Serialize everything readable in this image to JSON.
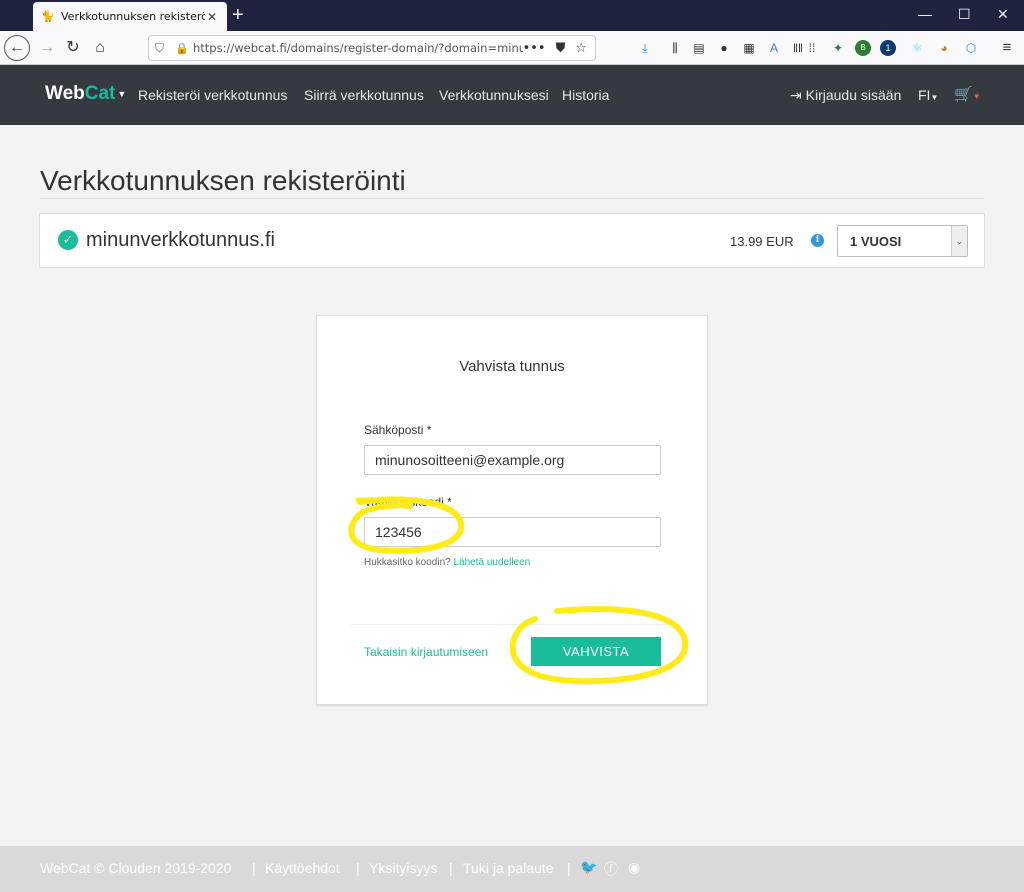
{
  "browser": {
    "tab_title": "Verkkotunnuksen rekisteröinti |",
    "url": "https://webcat.fi/domains/register-domain/?domain=minunve",
    "new_tab": "+",
    "menu": "≡"
  },
  "header": {
    "brand_web": "Web",
    "brand_cat": "Cat",
    "nav": [
      "Rekisteröi verkkotunnus",
      "Siirrä verkkotunnus",
      "Verkkotunnuksesi",
      "Historia"
    ],
    "login": "Kirjaudu sisään",
    "lang": "FI"
  },
  "page": {
    "title": "Verkkotunnuksen rekisteröinti",
    "domain": "minunverkkotunnus.fi",
    "price": "13.99 EUR",
    "period": "1 VUOSI"
  },
  "form": {
    "title": "Vahvista tunnus",
    "email_label": "Sähköposti *",
    "email_value": "minunosoitteeni@example.org",
    "code_label": "Vahvistuskoodi *",
    "code_value": "123456",
    "help_text": "Hukkasitko koodin?",
    "resend_link": "Lähetä uudelleen",
    "back_link": "Takaisin kirjautumiseen",
    "confirm_button": "VAHVISTA"
  },
  "footer": {
    "copyright": "WebCat © Clouden 2019-2020",
    "links": [
      "Käyttöehdot",
      "Yksityisyys",
      "Tuki ja palaute"
    ]
  },
  "colors": {
    "accent": "#1abc9c",
    "header_bg": "#343a40",
    "annotation": "#ffeb1a"
  }
}
